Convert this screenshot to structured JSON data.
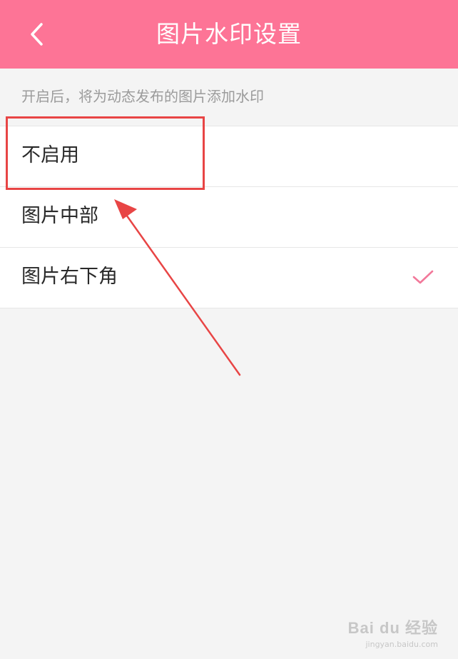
{
  "header": {
    "title": "图片水印设置",
    "bg_color": "#fd7496"
  },
  "hint": "开启后，将为动态发布的图片添加水印",
  "options": [
    {
      "label": "不启用",
      "selected": false
    },
    {
      "label": "图片中部",
      "selected": false
    },
    {
      "label": "图片右下角",
      "selected": true
    }
  ],
  "accent_color": "#f2789a",
  "annotation_color": "#e84545",
  "icons": {
    "back": "chevron-left-icon",
    "check": "check-icon"
  },
  "watermark": {
    "brand": "Bai du 经验",
    "url": "jingyan.baidu.com"
  }
}
